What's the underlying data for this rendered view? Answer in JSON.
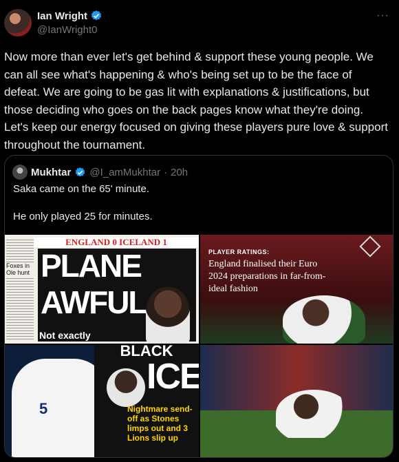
{
  "author": {
    "name": "Ian Wright",
    "handle": "@IanWright0"
  },
  "menu_icon": "more-horizontal-icon",
  "tweet": {
    "text": "Now more than ever let's get behind & support these young people. We can all see what's happening & who's being set up to be the face of defeat. We are going to be gas lit with explanations & justifications, but those deciding who goes on the back pages know what they're doing. Let's keep our energy focused on giving these players pure love & support throughout the tournament."
  },
  "quote": {
    "name": "Mukhtar",
    "handle": "@I_amMukhtar",
    "sep": "·",
    "time": "20h",
    "text": "Saka came on the 65' minute.\n\nHe only played 25 for minutes."
  },
  "media": {
    "tile1": {
      "banner": "ENGLAND 0 ICELAND 1",
      "headline_1": "PLANE",
      "headline_2": "AWFUL",
      "strap": "Not exactly",
      "side": "Foxes in Ole hunt"
    },
    "tile2": {
      "label": "PLAYER RATINGS:",
      "title": "England finalised their Euro 2024 preparations in far-from-ideal fashion"
    },
    "tile3": {
      "top": "BLACK",
      "big": "ICE",
      "shirt_number": "5",
      "strap": "Nightmare send-off as Stones limps out and 3 Lions slip up"
    }
  },
  "colors": {
    "background": "#000000",
    "text": "#e7e9ea",
    "muted": "#71767b",
    "verified": "#1d9bf0",
    "border": "#2f3336"
  }
}
